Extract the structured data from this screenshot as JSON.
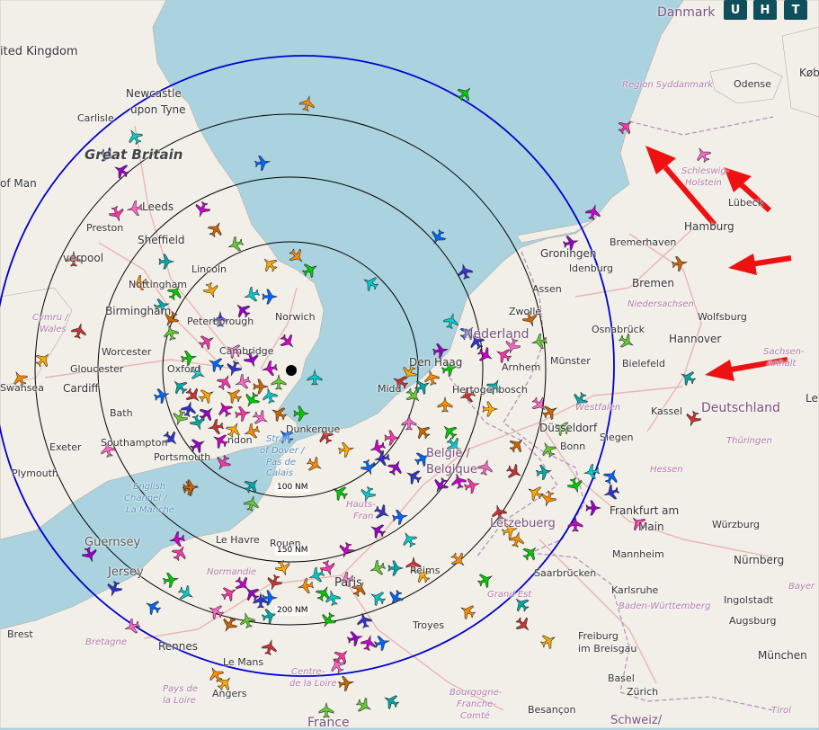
{
  "controls": [
    {
      "id": "U",
      "label": "U"
    },
    {
      "id": "H",
      "label": "H"
    },
    {
      "id": "T",
      "label": "T"
    }
  ],
  "range_rings": [
    "100 NM",
    "150 NM",
    "200 NM"
  ],
  "colors": {
    "sea": "#aad3df",
    "land": "#f2efe9",
    "outer_ring": "#0000cc",
    "ring": "#000000",
    "arrow": "#ee1111",
    "road": "#e8b7b7"
  },
  "map_labels": {
    "united_kingdom": "ited Kingdom",
    "great_britain": "Great Britain",
    "newcastle_1": "Newcastle",
    "newcastle_2": "upon Tyne",
    "carlisle": "Carlisle",
    "isle_of_man": "of Man",
    "leeds": "Leeds",
    "preston": "Preston",
    "sheffield": "Sheffield",
    "liverpool": "verpool",
    "lincoln": "Lincoln",
    "nottingham": "Nottingham",
    "birmingham": "Birmingham",
    "cymru_1": "Cymru /",
    "cymru_2": "Wales",
    "peterborough": "Peterborough",
    "norwich": "Norwich",
    "cambridge": "Cambridge",
    "worcester": "Worcester",
    "gloucester": "Gloucester",
    "oxford": "Oxford",
    "swansea": "Swansea",
    "cardiff": "Cardiff",
    "bath": "Bath",
    "exeter": "Exeter",
    "southampton": "Southampton",
    "portsmouth": "Portsmouth",
    "london": "ndon",
    "plymouth": "Plymouth",
    "channel_1": "English",
    "channel_2": "Channel /",
    "channel_3": "La Manche",
    "dover_1": "Strait",
    "dover_2": "of Dover /",
    "dover_3": "Pas de",
    "dover_4": "Calais",
    "dunkerque": "Dunkerque",
    "guernsey": "Guernsey",
    "jersey": "Jersey",
    "le_havre": "Le Havre",
    "rouen": "Rouen",
    "normandie": "Normandie",
    "hauts_de_france_1": "Hauts-",
    "hauts_de_france_2": "Fran",
    "paris": "Paris",
    "reims": "Reims",
    "brest": "Brest",
    "bretagne": "Bretagne",
    "rennes": "Rennes",
    "le_mans": "Le Mans",
    "troyes": "Troyes",
    "centre_1": "Centre-",
    "centre_2": "de la Loire",
    "pays_1": "Pays de",
    "pays_2": "la Loire",
    "angers": "Angers",
    "france": "France",
    "bourgogne_1": "Bourgogne-",
    "bourgogne_2": "Franche-",
    "bourgogne_3": "Comté",
    "besancon": "Besançon",
    "grand_est": "Grand Est",
    "danmark": "Danmark",
    "kob": "Køb",
    "odense": "Odense",
    "syddanmark": "Region Syddanmark",
    "schleswig_1": "Schleswig-",
    "schleswig_2": "Holstein",
    "lubeck": "Lübeck",
    "hamburg": "Hamburg",
    "bremerhaven": "Bremerhaven",
    "bremen": "Bremen",
    "niedersachsen": "Niedersachsen",
    "wolfsburg": "Wolfsburg",
    "hannover": "Hannover",
    "sachsen_1": "Sachsen-",
    "sachsen_2": "Anhalt",
    "bielefeld": "Bielefeld",
    "osnabruck": "Osnabrück",
    "groningen": "Groningen",
    "oldenburg": "ldenburg",
    "assen": "Assen",
    "zwolle": "Zwolle",
    "nederland": "Nederland",
    "den_haag": "Den Haag",
    "arnhem": "Arnhem",
    "hertogenbosch": "Hertogenbosch",
    "middelburg": "Midd",
    "munster": "Münster",
    "westfalen": "Westfalen",
    "dusseldorf": "Düsseldorf",
    "bonn": "Bonn",
    "siegen": "Siegen",
    "kassel": "Kassel",
    "deutschland": "Deutschland",
    "thuringen": "Thüringen",
    "hessen": "Hessen",
    "belgie_1": "België /",
    "belgie_2": "Belgique",
    "luxembourg": "Lëtzebuerg",
    "frankfurt_1": "Frankfurt am",
    "frankfurt_2": "Main",
    "wurzburg": "Würzburg",
    "mannheim": "Mannheim",
    "nurnberg": "Nürnberg",
    "saarbrucken": "Saarbrücken",
    "karlsruhe": "Karlsruhe",
    "ingolstadt": "Ingolstadt",
    "bayern": "Bayer",
    "baden": "Baden-Württemberg",
    "augsburg": "Augsburg",
    "freiburg_1": "Freiburg",
    "freiburg_2": "im Breisgau",
    "munchen": "München",
    "basel": "Basel",
    "zurich": "Zürich",
    "schweiz": "Schweiz/",
    "tirol": "Tirol",
    "le_edge": "Le"
  },
  "aircraft_colors": [
    "#ff8c00",
    "#00cc00",
    "#00cccc",
    "#0066ff",
    "#3333cc",
    "#9900cc",
    "#cc00cc",
    "#ff33aa",
    "#ff66cc",
    "#cc6600",
    "#66cc33",
    "#00aaaa",
    "#cc3333",
    "#ffaa00"
  ]
}
